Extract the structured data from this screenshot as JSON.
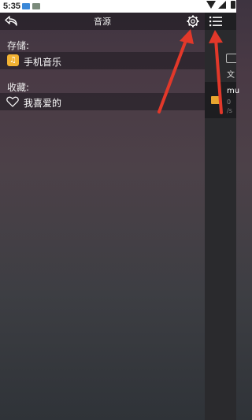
{
  "status_bar": {
    "time": "5:35"
  },
  "header": {
    "title": "音源"
  },
  "storage": {
    "section_label": "存储:",
    "items": [
      {
        "label": "手机音乐",
        "icon": "music-note-icon"
      }
    ]
  },
  "favorites": {
    "section_label": "收藏:",
    "items": [
      {
        "label": "我喜爱的",
        "icon": "heart-icon"
      }
    ]
  },
  "side_panel": {
    "folder_label": "文",
    "item_name": "mu",
    "item_sub1": "0",
    "item_sub2": "/s"
  },
  "colors": {
    "arrow": "#e2382a",
    "music_icon": "#f2b233",
    "folder": "#e8a530"
  }
}
